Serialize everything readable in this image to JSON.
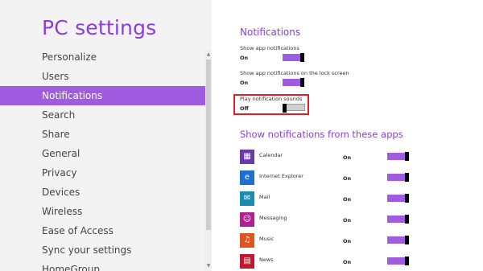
{
  "app_title": "PC settings",
  "nav": [
    {
      "label": "Personalize"
    },
    {
      "label": "Users"
    },
    {
      "label": "Notifications",
      "active": true
    },
    {
      "label": "Search"
    },
    {
      "label": "Share"
    },
    {
      "label": "General"
    },
    {
      "label": "Privacy"
    },
    {
      "label": "Devices"
    },
    {
      "label": "Wireless"
    },
    {
      "label": "Ease of Access"
    },
    {
      "label": "Sync your settings"
    },
    {
      "label": "HomeGroup"
    }
  ],
  "notifications": {
    "title": "Notifications",
    "settings": [
      {
        "label": "Show app notifications",
        "value": "On"
      },
      {
        "label": "Show app notifications on the lock screen",
        "value": "On"
      },
      {
        "label": "Play notification sounds",
        "value": "Off"
      }
    ]
  },
  "apps": {
    "title": "Show notifications from these apps",
    "items": [
      {
        "name": "Calendar",
        "state": "On",
        "icon": "calendar-icon",
        "color": "#6b3aa8"
      },
      {
        "name": "Internet Explorer",
        "state": "On",
        "icon": "internet-explorer-icon",
        "color": "#1f6fd1"
      },
      {
        "name": "Mail",
        "state": "On",
        "icon": "mail-icon",
        "color": "#1c8bb0"
      },
      {
        "name": "Messaging",
        "state": "On",
        "icon": "messaging-icon",
        "color": "#b0208e"
      },
      {
        "name": "Music",
        "state": "On",
        "icon": "music-icon",
        "color": "#e0541f"
      },
      {
        "name": "News",
        "state": "On",
        "icon": "news-icon",
        "color": "#c0182f"
      }
    ]
  },
  "colors": {
    "accent": "#8a3ce0",
    "toggle_on": "#a05ce0",
    "highlight_border": "#e02020"
  }
}
